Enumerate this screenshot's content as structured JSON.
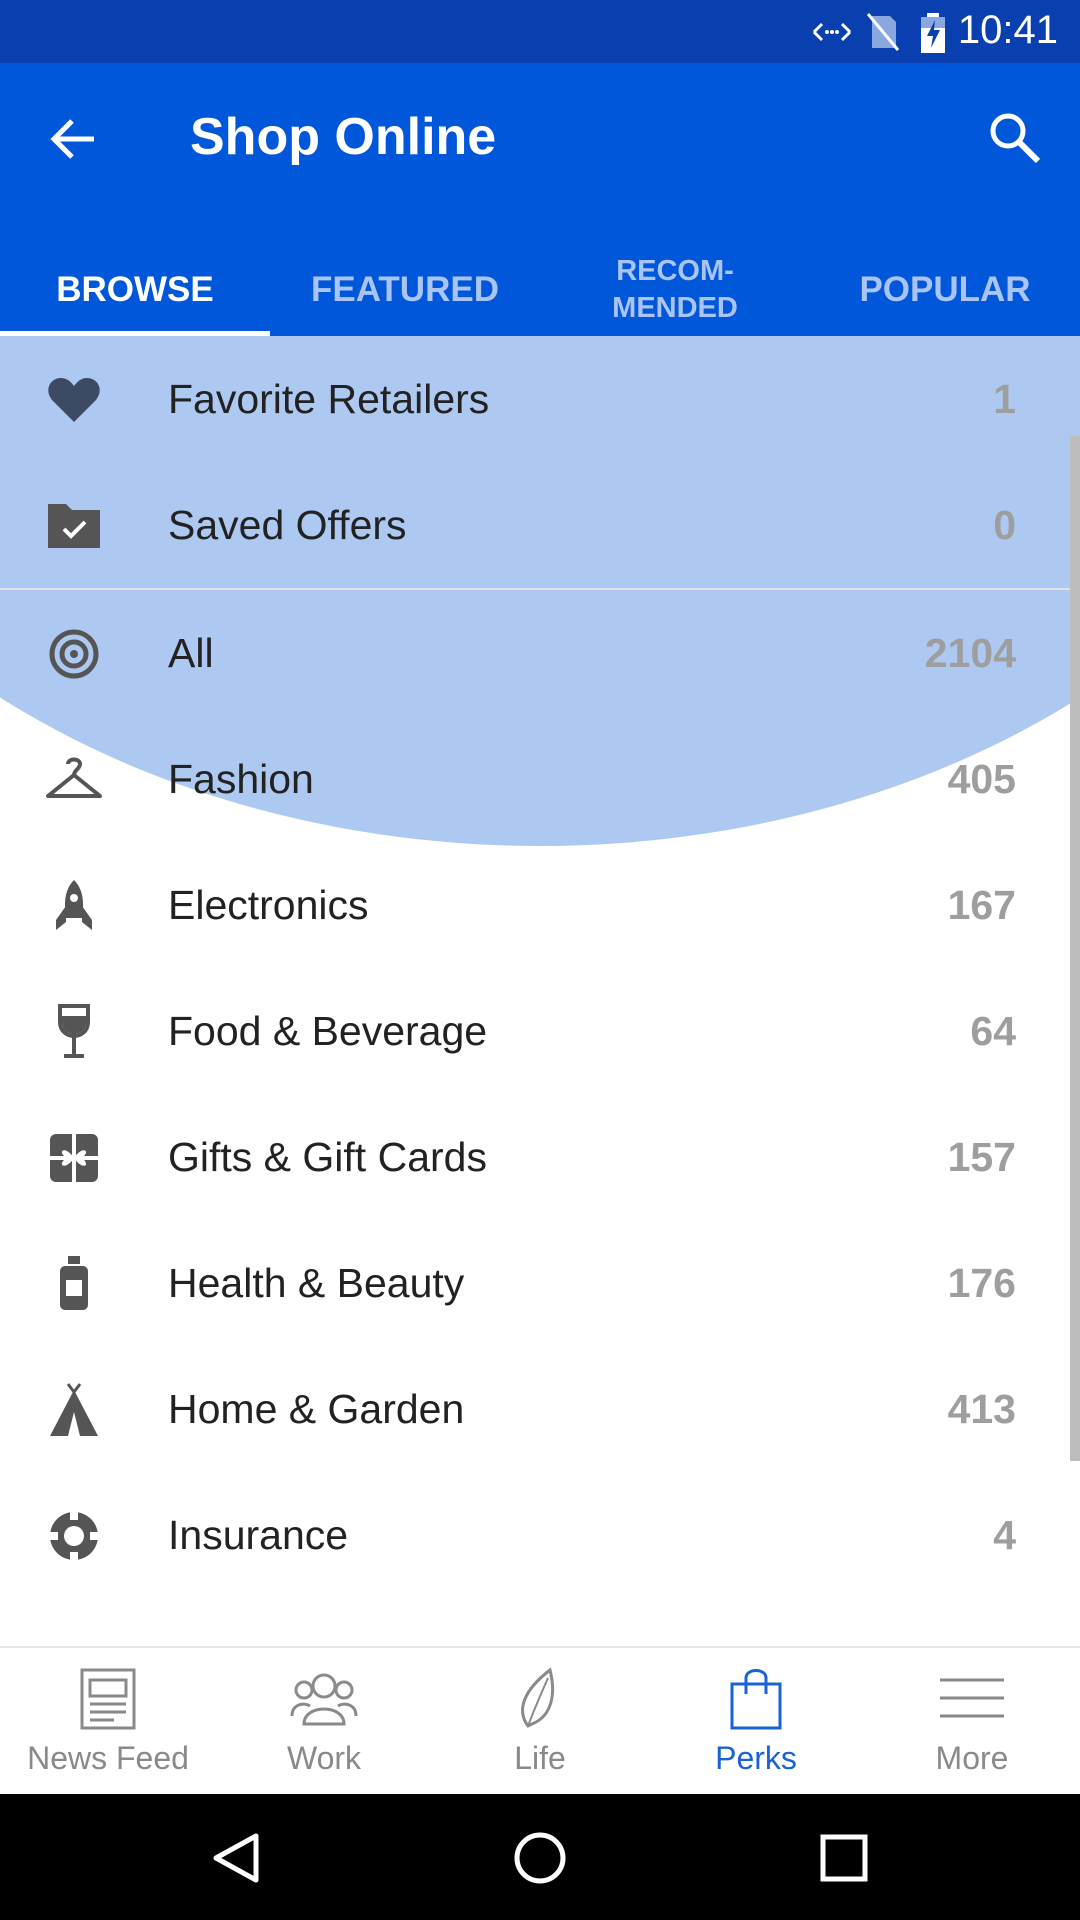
{
  "status_bar": {
    "time": "10:41"
  },
  "app_bar": {
    "title": "Shop Online"
  },
  "tabs": [
    {
      "label": "BROWSE",
      "active": true
    },
    {
      "label": "FEATURED",
      "active": false
    },
    {
      "label": "RECOM-\nMENDED",
      "active": false
    },
    {
      "label": "POPULAR",
      "active": false
    }
  ],
  "list": {
    "items": [
      {
        "icon": "heart-icon",
        "label": "Favorite Retailers",
        "count": "1"
      },
      {
        "icon": "folder-check-icon",
        "label": "Saved Offers",
        "count": "0"
      },
      {
        "icon": "target-icon",
        "label": "All",
        "count": "2104"
      },
      {
        "icon": "hanger-icon",
        "label": "Fashion",
        "count": "405"
      },
      {
        "icon": "rocket-icon",
        "label": "Electronics",
        "count": "167"
      },
      {
        "icon": "wine-glass-icon",
        "label": "Food & Beverage",
        "count": "64"
      },
      {
        "icon": "gift-icon",
        "label": "Gifts & Gift Cards",
        "count": "157"
      },
      {
        "icon": "bottle-icon",
        "label": "Health & Beauty",
        "count": "176"
      },
      {
        "icon": "tent-icon",
        "label": "Home & Garden",
        "count": "413"
      },
      {
        "icon": "lifebuoy-icon",
        "label": "Insurance",
        "count": "4"
      }
    ]
  },
  "bottom_nav": [
    {
      "icon": "newspaper-icon",
      "label": "News Feed",
      "active": false
    },
    {
      "icon": "people-icon",
      "label": "Work",
      "active": false
    },
    {
      "icon": "leaf-icon",
      "label": "Life",
      "active": false
    },
    {
      "icon": "shopping-bag-icon",
      "label": "Perks",
      "active": true
    },
    {
      "icon": "menu-icon",
      "label": "More",
      "active": false
    }
  ],
  "colors": {
    "status_bar": "#0a3fb0",
    "app_bar": "#0157d9",
    "accent": "#1a63d6",
    "highlight": "#adc9f2"
  }
}
